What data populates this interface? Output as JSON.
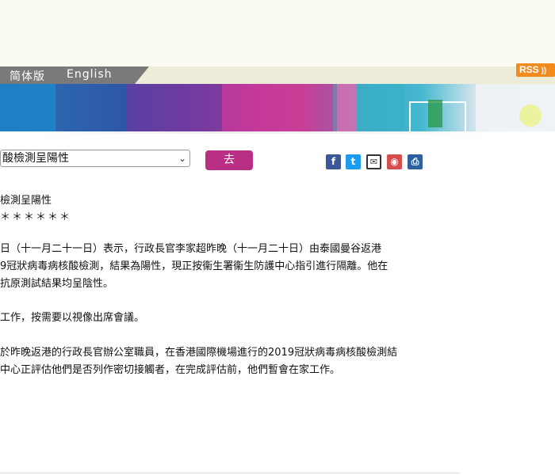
{
  "language_bar": {
    "traditional": "",
    "simplified": "简体版",
    "english": "English"
  },
  "rss": {
    "label": "RSS"
  },
  "controls": {
    "selected_title": "酸檢測呈陽性",
    "go_label": "去"
  },
  "share": [
    "facebook-icon",
    "twitter-icon",
    "email-icon",
    "weibo-icon",
    "print-icon"
  ],
  "article": {
    "title": "檢測呈陽性",
    "stars": "＊＊＊＊＊＊",
    "p1": [
      "日（十一月二十一日）表示，行政長官李家超昨晚（十一月二十日）由泰國曼谷返港",
      "9冠狀病毒病核酸檢測，結果為陽性，現正按衞生署衞生防護中心指引進行隔離。他在",
      "抗原測試結果均呈陰性。"
    ],
    "p2": [
      "工作，按需要以視像出席會議。"
    ],
    "p3": [
      "於昨晚返港的行政長官辦公室職員，在香港國際機場進行的2019冠狀病毒病核酸檢測結",
      "中心正評估他們是否列作密切接觸者，在完成評估前，他們暫會在家工作。"
    ]
  },
  "colors": {
    "accent": "#b92f86",
    "tab_gray": "#7a7a7a",
    "rss_orange": "#f18b1d"
  }
}
